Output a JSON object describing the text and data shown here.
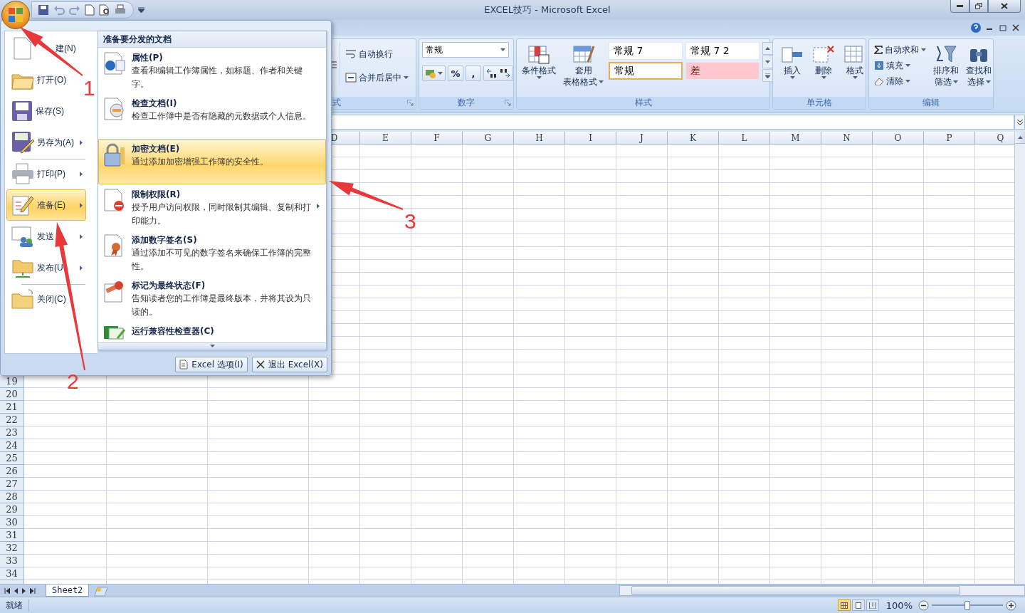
{
  "window": {
    "title": "EXCEL技巧 - Microsoft Excel"
  },
  "ribbon": {
    "groups": [
      {
        "kind": "alignment",
        "label": "式",
        "buttons": [
          {
            "label": "自动换行",
            "dropdown": false
          },
          {
            "label": "合并后居中",
            "dropdown": true
          }
        ]
      },
      {
        "kind": "number",
        "label": "数字",
        "format": "常规",
        "symbols": [
          "%",
          ","
        ]
      },
      {
        "kind": "styles",
        "label": "样式",
        "buttons": [
          {
            "lines": [
              "条件格式"
            ]
          },
          {
            "lines": [
              "套用",
              "表格格式"
            ]
          }
        ],
        "gallery": [
          {
            "label": "常规 7",
            "kind": "plain",
            "selected": false
          },
          {
            "label": "常规 7 2",
            "kind": "plain",
            "selected": false
          },
          {
            "label": "常规",
            "kind": "plain",
            "selected": true
          },
          {
            "label": "差",
            "kind": "bad",
            "selected": false
          }
        ]
      },
      {
        "kind": "cells",
        "label": "单元格",
        "buttons": [
          {
            "lines": [
              "插入"
            ]
          },
          {
            "lines": [
              "删除"
            ]
          },
          {
            "lines": [
              "格式"
            ]
          }
        ]
      },
      {
        "kind": "editing",
        "label": "编辑",
        "small": [
          {
            "label": "自动求和"
          },
          {
            "label": "填充"
          },
          {
            "label": "清除"
          }
        ],
        "buttons": [
          {
            "lines": [
              "排序和",
              "筛选"
            ]
          },
          {
            "lines": [
              "查找和",
              "选择"
            ]
          }
        ]
      }
    ]
  },
  "columns": [
    "D",
    "E",
    "F",
    "G",
    "H",
    "I",
    "J",
    "K",
    "L",
    "M",
    "N",
    "O",
    "P",
    "Q"
  ],
  "rows": [
    "19",
    "20",
    "21",
    "22",
    "23",
    "24",
    "25",
    "26",
    "27",
    "28",
    "29",
    "30",
    "31",
    "32",
    "33",
    "34"
  ],
  "sheet_tabs": [
    {
      "label": "Sheet2",
      "selected": true
    }
  ],
  "status_bar": {
    "text": "就绪",
    "zoom": "100%",
    "views": [
      {
        "kind": "normal",
        "selected": true
      },
      {
        "kind": "layout",
        "selected": false
      },
      {
        "kind": "pagebreak",
        "selected": false
      }
    ],
    "zoom_slider": {
      "level": 0.5
    }
  },
  "office_menu": {
    "items": [
      {
        "kind": "new",
        "label": "建(N)",
        "submenu": false,
        "selected": false,
        "divider_before": false
      },
      {
        "kind": "open",
        "label": "打开(O)",
        "submenu": false,
        "selected": false,
        "divider_before": false
      },
      {
        "kind": "save",
        "label": "保存(S)",
        "submenu": false,
        "selected": false,
        "divider_before": false
      },
      {
        "kind": "saveas",
        "label": "另存为(A)",
        "submenu": true,
        "selected": false,
        "divider_before": false
      },
      {
        "kind": "print",
        "label": "打印(P)",
        "submenu": true,
        "selected": false,
        "divider_before": true
      },
      {
        "kind": "prepare",
        "label": "准备(E)",
        "submenu": true,
        "selected": true,
        "divider_before": false
      },
      {
        "kind": "send",
        "label": "发送",
        "submenu": true,
        "selected": false,
        "divider_before": false
      },
      {
        "kind": "publish",
        "label": "发布(U",
        "submenu": true,
        "selected": false,
        "divider_before": false
      },
      {
        "kind": "close",
        "label": "关闭(C)",
        "submenu": false,
        "selected": false,
        "divider_before": true
      }
    ],
    "panel": {
      "title": "准备要分发的文档",
      "items": [
        {
          "kind": "properties",
          "title": "属性(P)",
          "description": "查看和编辑工作簿属性，如标题、作者和关键字。",
          "selected": false,
          "submenu": false
        },
        {
          "kind": "inspect",
          "title": "检查文档(I)",
          "description": "检查工作簿中是否有隐藏的元数据或个人信息。",
          "selected": false,
          "submenu": false
        },
        {
          "kind": "encrypt",
          "title": "加密文档(E)",
          "description": "通过添加加密增强工作簿的安全性。",
          "selected": true,
          "submenu": false
        },
        {
          "kind": "restrict",
          "title": "限制权限(R)",
          "description": "授予用户访问权限，同时限制其编辑、复制和打印能力。",
          "selected": false,
          "submenu": true
        },
        {
          "kind": "signature",
          "title": "添加数字签名(S)",
          "description": "通过添加不可见的数字签名来确保工作簿的完整性。",
          "selected": false,
          "submenu": false
        },
        {
          "kind": "final",
          "title": "标记为最终状态(F)",
          "description": "告知读者您的工作簿是最终版本，并将其设为只读的。",
          "selected": false,
          "submenu": false
        },
        {
          "kind": "compat",
          "title": "运行兼容性检查器(C)",
          "selected": false,
          "submenu": false
        }
      ]
    },
    "buttons": [
      "Excel 选项(I)",
      "退出 Excel(X)"
    ]
  },
  "annotations": [
    {
      "label": "1"
    },
    {
      "label": "2"
    },
    {
      "label": "3"
    }
  ]
}
